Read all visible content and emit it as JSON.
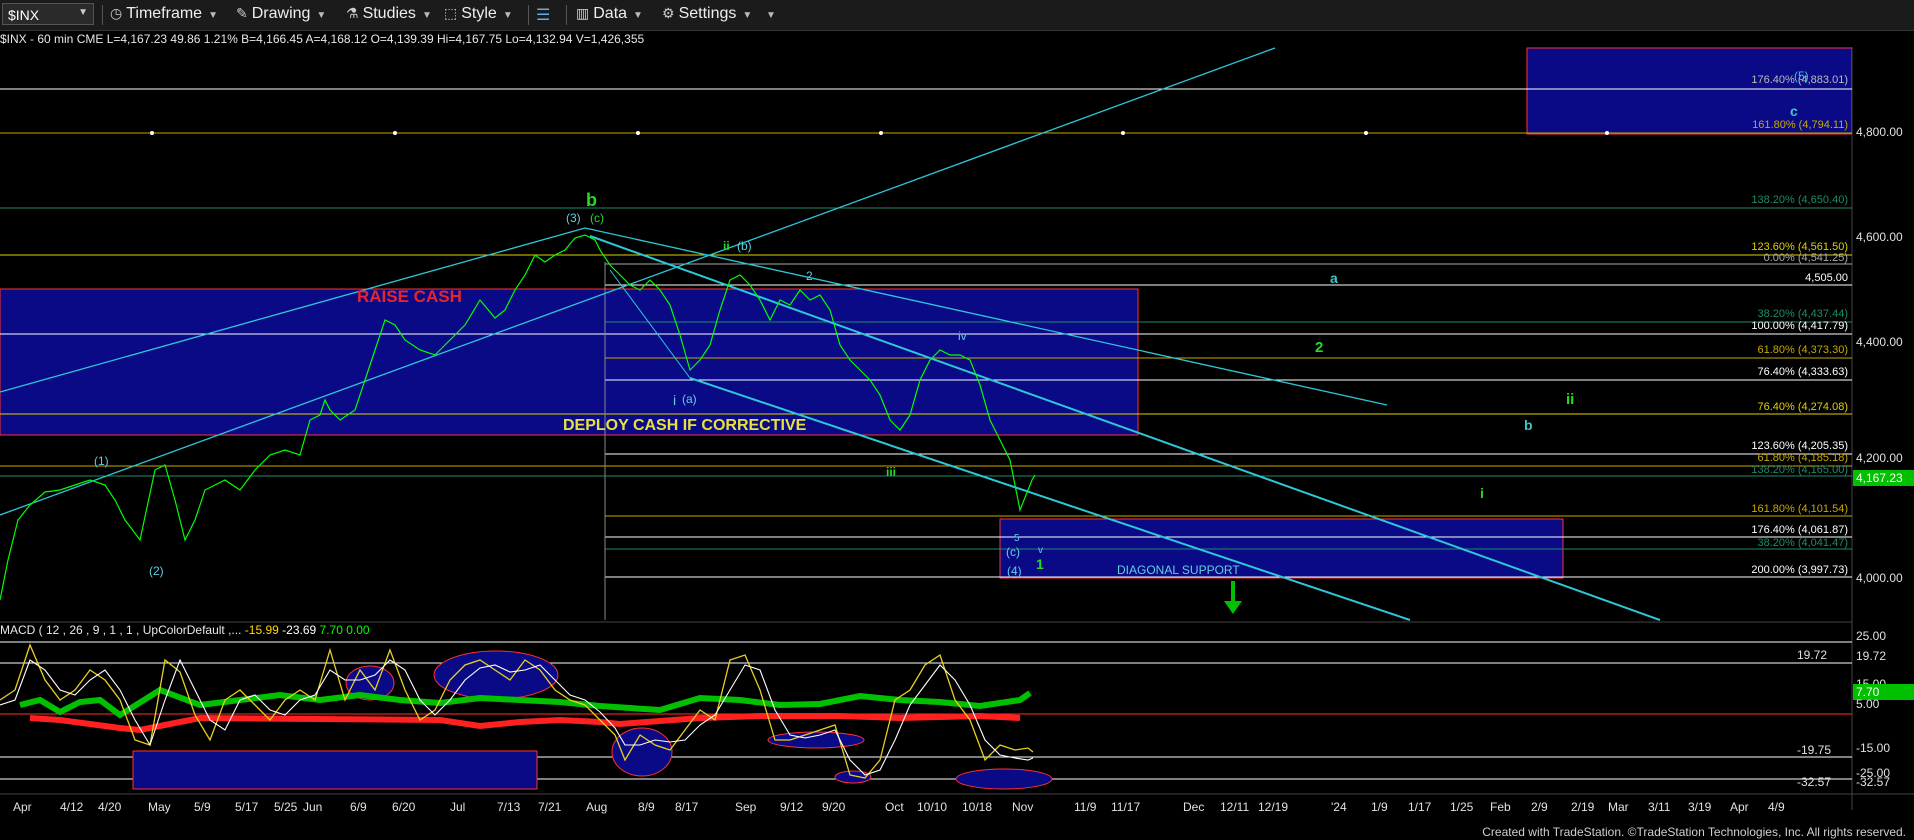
{
  "toolbar": {
    "symbol": "$INX",
    "timeframe": "Timeframe",
    "drawing": "Drawing",
    "studies": "Studies",
    "style": "Style",
    "data": "Data",
    "settings": "Settings"
  },
  "header": {
    "text": "$INX - 60 min  CME  L=4,167.23  49.86  1.21%  B=4,166.45  A=4,168.12  O=4,139.39  Hi=4,167.75  Lo=4,132.94  V=1,426,355"
  },
  "macd": {
    "label": "MACD ( 12 , 26 , 9 , 1 , 1 , UpColorDefault ,...",
    "v1": "-15.99",
    "v2": "-23.69",
    "v3": "7.70",
    "v4": "0.00",
    "v1_color": "#ffd700",
    "v2_color": "#ffffff",
    "v3_color": "#00ff00",
    "v4_color": "#00ff00"
  },
  "price_axis": [
    "4,800.00",
    "4,600.00",
    "4,400.00",
    "4,200.00",
    "4,000.00"
  ],
  "last_price": "4,167.23",
  "macd_axis": [
    "25.00",
    "19.72",
    "15.00",
    "7.70",
    "5.00",
    "-15.00",
    "-19.75",
    "-25.00",
    "-32.57"
  ],
  "fib_levels": [
    "176.40% (4,883.01)",
    "161.80% (4,794.11)",
    "138.20% (4,650.40)",
    "123.60% (4,561.50)",
    "0.00% (4,541.25)",
    "4,505.00",
    "38.20% (4,437.44)",
    "100.00% (4,417.79)",
    "61.80% (4,373.30)",
    "76.40% (4,333.63)",
    "76.40% (4,274.08)",
    "123.60% (4,205.35)",
    "61.80% (4,185.18)",
    "138.20% (4,165.00)",
    "161.80% (4,101.54)",
    "176.40% (4,061.87)",
    "38.20% (4,041.47)",
    "200.00% (3,997.73)"
  ],
  "annotations": {
    "raise_cash": "RAISE CASH",
    "deploy_cash": "DEPLOY CASH IF CORRECTIVE",
    "diagonal_support": "DIAGONAL SUPPORT"
  },
  "wave_labels": [
    "b",
    "(3)",
    "(c)",
    "ii",
    "(b)",
    "2",
    "iv",
    "i",
    "(a)",
    "iii",
    "(1)",
    "(2)",
    "(c)",
    "(4)",
    "5",
    "v",
    "1",
    "a",
    "2",
    "ii",
    "b",
    "i",
    "c",
    "(5)"
  ],
  "x_axis": [
    "Apr",
    "4/12",
    "4/20",
    "May",
    "5/9",
    "5/17",
    "5/25",
    "Jun",
    "6/9",
    "6/20",
    "Jul",
    "7/13",
    "7/21",
    "Aug",
    "8/9",
    "8/17",
    "Sep",
    "9/12",
    "9/20",
    "Oct",
    "10/10",
    "10/18",
    "Nov",
    "11/9",
    "11/17",
    "Dec",
    "12/11",
    "12/19",
    "'24",
    "1/9",
    "1/17",
    "1/25",
    "Feb",
    "2/9",
    "2/19",
    "Mar",
    "3/11",
    "3/19",
    "Apr",
    "4/9"
  ],
  "footer": "Created with TradeStation. ©TradeStation Technologies, Inc. All rights reserved."
}
